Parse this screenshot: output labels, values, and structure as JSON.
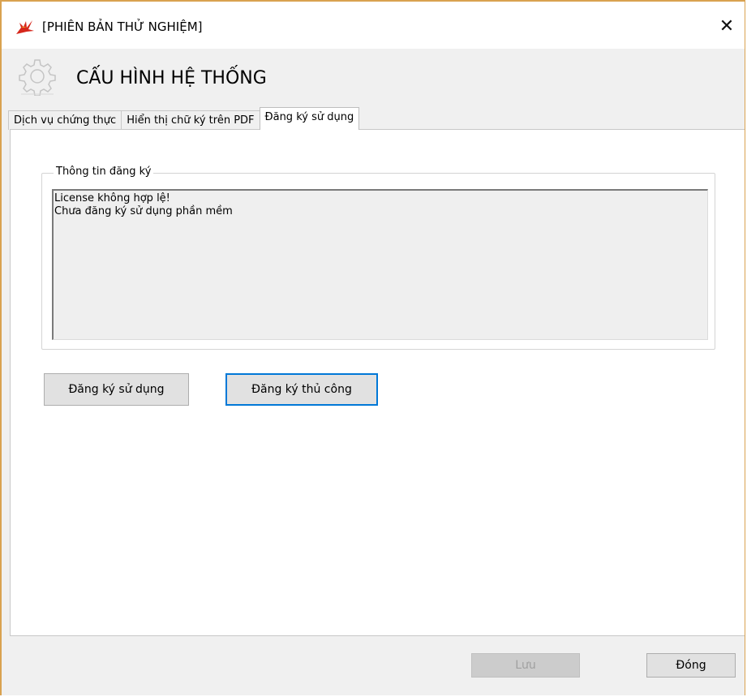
{
  "window": {
    "title": "[PHIÊN BẢN THỬ NGHIỆM]",
    "close_symbol": "✕",
    "app_icon": "app-logo-icon",
    "border_color": "#d9a250"
  },
  "header": {
    "title": "CẤU HÌNH HỆ THỐNG",
    "icon": "gear-icon"
  },
  "tabs": [
    {
      "label": "Dịch vụ chứng thực",
      "active": false
    },
    {
      "label": "Hiển thị chữ ký trên PDF",
      "active": false
    },
    {
      "label": "Đăng ký sử dụng",
      "active": true
    }
  ],
  "registration": {
    "group_label": "Thông tin đăng ký",
    "info_lines": [
      "License không hợp lệ!",
      "Chưa đăng ký sử dụng phần mềm"
    ],
    "register_button": "Đăng ký sử dụng",
    "manual_register_button": "Đăng ký thủ công"
  },
  "footer": {
    "save_button": "Lưu",
    "save_enabled": false,
    "close_button": "Đóng"
  },
  "colors": {
    "focus": "#0078d7",
    "button_bg": "#e1e1e1",
    "window_bg": "#f0f0f0"
  }
}
